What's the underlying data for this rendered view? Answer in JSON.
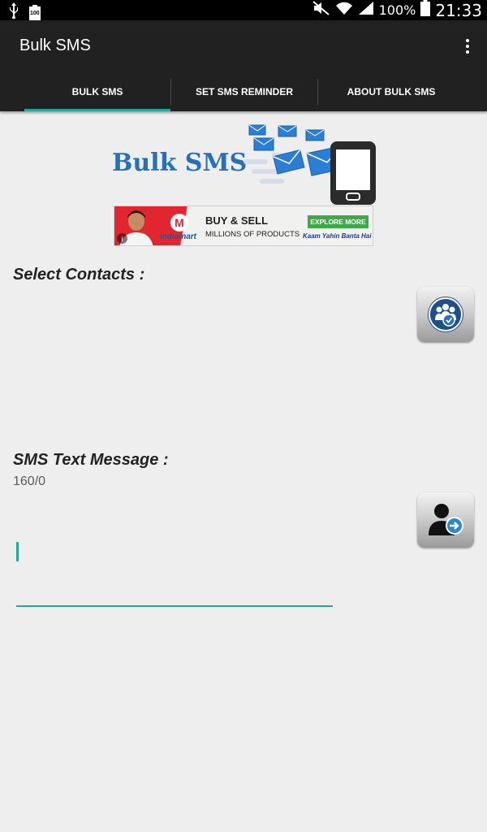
{
  "status_bar": {
    "battery_badge": "100",
    "battery_percent": "100%",
    "time": "21:33",
    "icons": [
      "usb-icon",
      "battery-100-icon",
      "mute-icon",
      "wifi-icon",
      "signal-icon",
      "battery-icon"
    ]
  },
  "app_bar": {
    "title": "Bulk SMS",
    "overflow_icon": "more-vert-icon"
  },
  "tabs": [
    {
      "label": "BULK SMS",
      "selected": true
    },
    {
      "label": "SET SMS REMINDER",
      "selected": false
    },
    {
      "label": "ABOUT BULK SMS",
      "selected": false
    }
  ],
  "logo": {
    "text": "Bulk SMS"
  },
  "ad": {
    "brand": "indiamart",
    "brand_initial": "M",
    "headline": "BUY & SELL",
    "subline": "MILLIONS OF PRODUCTS",
    "cta": "EXPLORE MORE",
    "tagline": "Kaam Yahin Banta Hai",
    "info_icon": "i"
  },
  "form": {
    "select_contacts_label": "Select Contacts  :",
    "sms_text_label": "SMS Text Message :",
    "char_counter": "160/0",
    "sms_value": ""
  },
  "colors": {
    "accent": "#26a69a",
    "app_bar": "#212121",
    "background": "#eeeeee",
    "logo_blue": "#2770b8"
  }
}
